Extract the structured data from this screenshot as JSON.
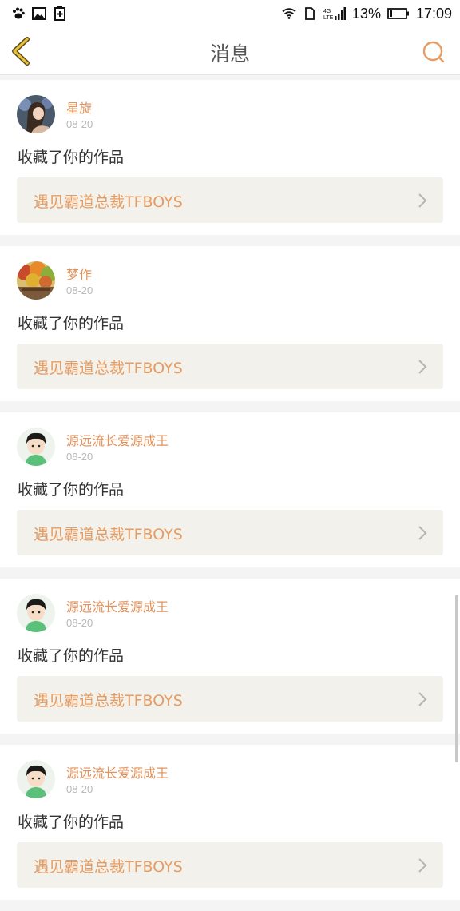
{
  "status_bar": {
    "battery_percent": "13%",
    "time": "17:09",
    "network": "4G"
  },
  "header": {
    "title": "消息"
  },
  "messages": [
    {
      "username": "星旋",
      "date": "08-20",
      "action": "收藏了你的作品",
      "work_title": "遇见霸道总裁TFBOYS",
      "avatar": "avatar-girl"
    },
    {
      "username": "梦作",
      "date": "08-20",
      "action": "收藏了你的作品",
      "work_title": "遇见霸道总裁TFBOYS",
      "avatar": "avatar-autumn"
    },
    {
      "username": "源远流长爱源成王",
      "date": "08-20",
      "action": "收藏了你的作品",
      "work_title": "遇见霸道总裁TFBOYS",
      "avatar": "avatar-boy"
    },
    {
      "username": "源远流长爱源成王",
      "date": "08-20",
      "action": "收藏了你的作品",
      "work_title": "遇见霸道总裁TFBOYS",
      "avatar": "avatar-boy"
    },
    {
      "username": "源远流长爱源成王",
      "date": "08-20",
      "action": "收藏了你的作品",
      "work_title": "遇见霸道总裁TFBOYS",
      "avatar": "avatar-boy"
    }
  ],
  "colors": {
    "accent": "#e69c62",
    "back_arrow": "#e8c23a",
    "card_link_bg": "#f2f1eb"
  }
}
